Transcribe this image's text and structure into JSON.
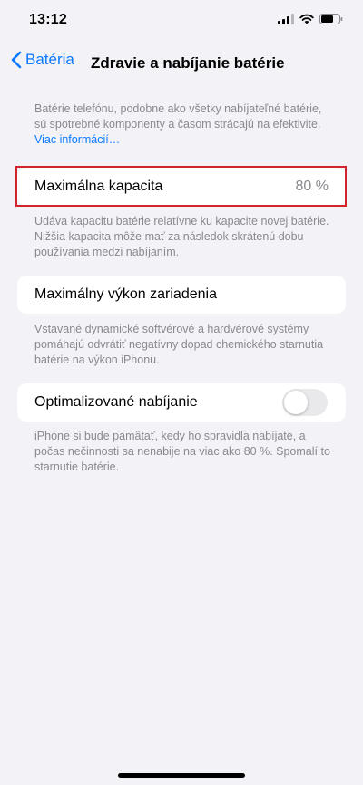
{
  "status_bar": {
    "time": "13:12"
  },
  "nav": {
    "back_label": "Batéria",
    "title": "Zdravie a nabíjanie batérie"
  },
  "intro": {
    "text": "Batérie telefónu, podobne ako všetky nabíjateľné batérie, sú spotrebné komponenty a časom strácajú na efektivite. ",
    "link": "Viac informácií…"
  },
  "max_capacity": {
    "label": "Maximálna kapacita",
    "value": "80 %",
    "note": "Udáva kapacitu batérie relatívne ku kapacite novej batérie. Nižšia kapacita môže mať za následok skrátenú dobu používania medzi nabíjaním."
  },
  "peak_performance": {
    "label": "Maximálny výkon zariadenia",
    "note": "Vstavané dynamické softvérové a hardvérové systémy pomáhajú odvrátiť negatívny dopad chemického starnutia batérie na výkon iPhonu."
  },
  "optimized_charging": {
    "label": "Optimalizované nabíjanie",
    "enabled": false,
    "note": "iPhone si bude pamätať, kedy ho spravidla nabíjate, a počas nečinnosti sa nenabije na viac ako 80 %. Spomalí to starnutie batérie."
  },
  "colors": {
    "accent": "#0a7aff",
    "highlight_border": "#d4242b",
    "background": "#f2f2f7",
    "secondary_text": "#8a8a8e"
  }
}
